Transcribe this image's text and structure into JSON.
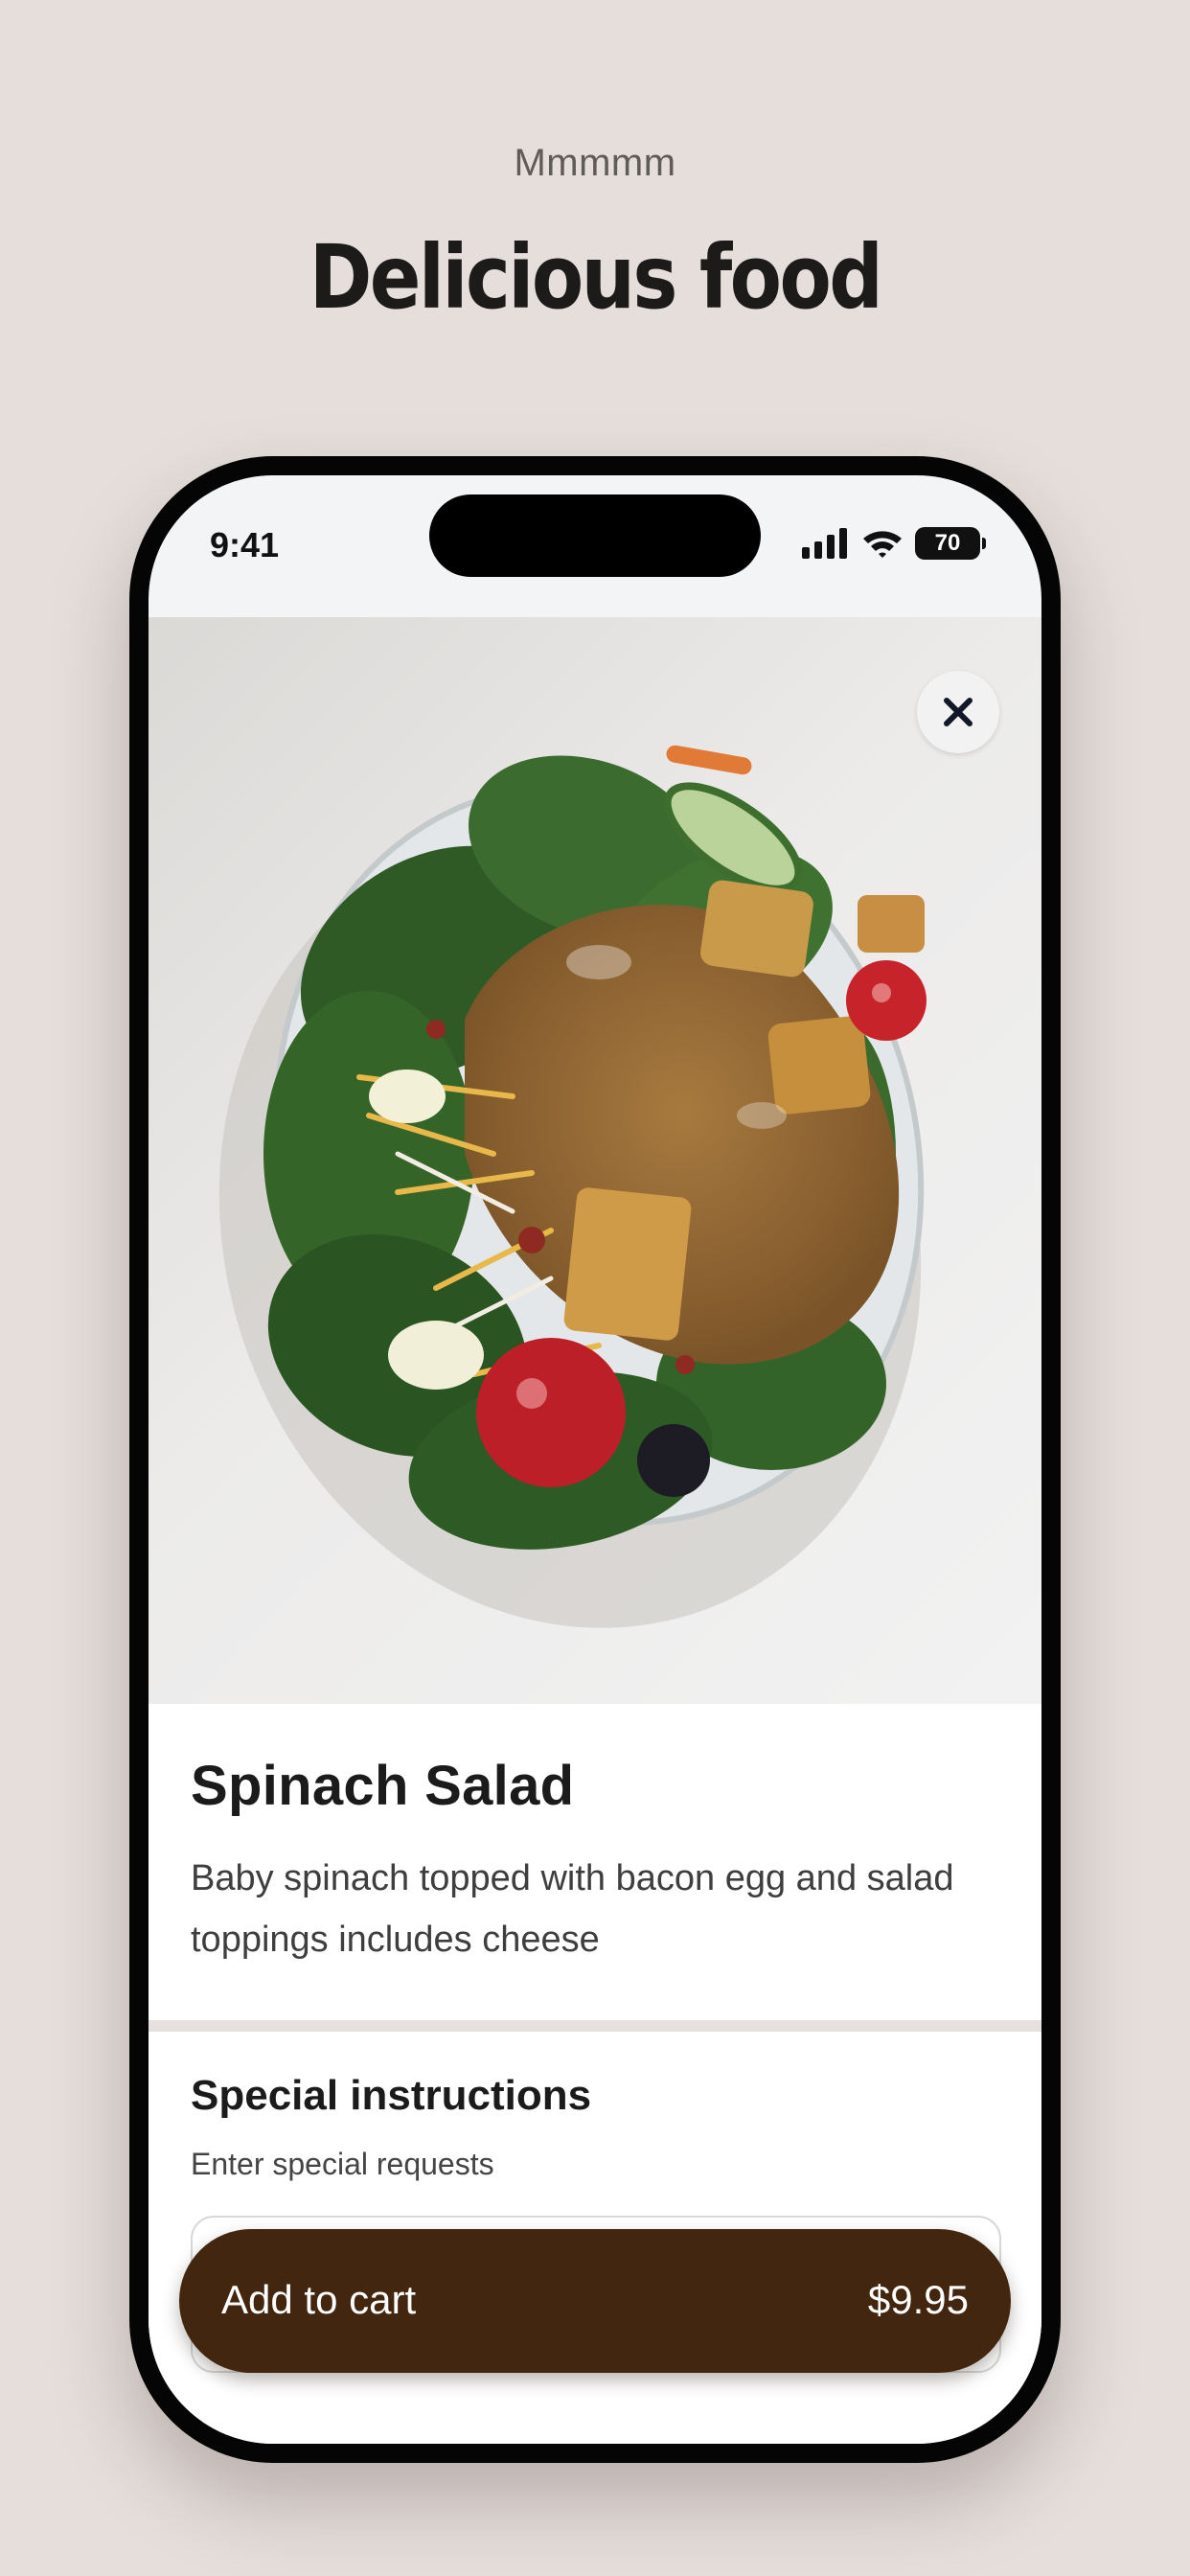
{
  "promo": {
    "subtitle": "Mmmmm",
    "title": "Delicious food"
  },
  "status_bar": {
    "time": "9:41",
    "battery": "70",
    "icons": [
      "cellular-signal-icon",
      "wifi-icon",
      "battery-icon"
    ]
  },
  "item": {
    "image": "spinach-salad-photo",
    "name": "Spinach Salad",
    "description": "Baby spinach topped with bacon egg and salad toppings includes cheese"
  },
  "instructions": {
    "title": "Special instructions",
    "hint": "Enter special requests",
    "value": ""
  },
  "cart_button": {
    "label": "Add to cart",
    "price": "$9.95"
  },
  "colors": {
    "background": "#e5dedb",
    "button": "#432610",
    "divider": "#e6e1de"
  }
}
